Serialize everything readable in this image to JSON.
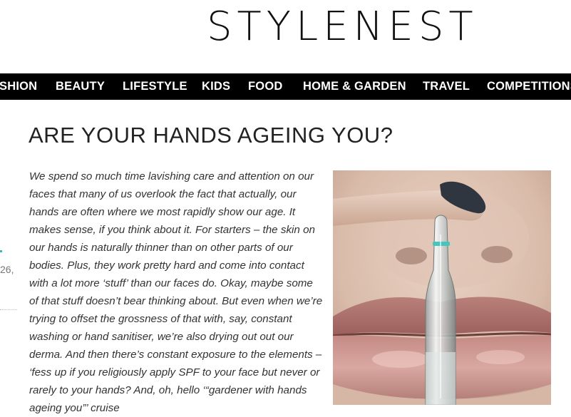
{
  "site": {
    "logo": "STYLENEST"
  },
  "nav": {
    "items": [
      {
        "label": "SHION",
        "name": "nav-fashion"
      },
      {
        "label": "BEAUTY",
        "name": "nav-beauty"
      },
      {
        "label": "LIFESTYLE",
        "name": "nav-lifestyle"
      },
      {
        "label": "KIDS",
        "name": "nav-kids"
      },
      {
        "label": "FOOD",
        "name": "nav-food"
      },
      {
        "label": "HOME & GARDEN",
        "name": "nav-home-garden"
      },
      {
        "label": "TRAVEL",
        "name": "nav-travel"
      },
      {
        "label": "COMPETITIONS",
        "name": "nav-competitions"
      }
    ]
  },
  "article": {
    "title": "ARE YOUR HANDS AGEING YOU?",
    "body": "We spend so much time lavishing care and attention on our faces that many of us overlook the fact that actually, our hands are often where we most rapidly show our age. It makes sense, if you think about it. For starters – the skin on our hands is naturally thinner than on other parts of our bodies. Plus, they work pretty hard and come into contact with a lot more ‘stuff’ than our faces do. Okay, maybe some of that stuff doesn’t bear thinking about. But even when we’re trying to offset the grossness of that with, say, constant washing or hand sanitiser, we’re also drying out out our derma. And then there’s constant exposure to the elements – ‘fess up if you religiously apply SPF to your face but never or rarely to your hands? And, oh, hello ‘“gardener with hands ageing you”’ cruise"
  },
  "sidebar": {
    "fragment": "26,"
  },
  "colors": {
    "nav_bg": "#000000",
    "nav_text": "#ffffff",
    "accent": "#3cb9b4"
  }
}
